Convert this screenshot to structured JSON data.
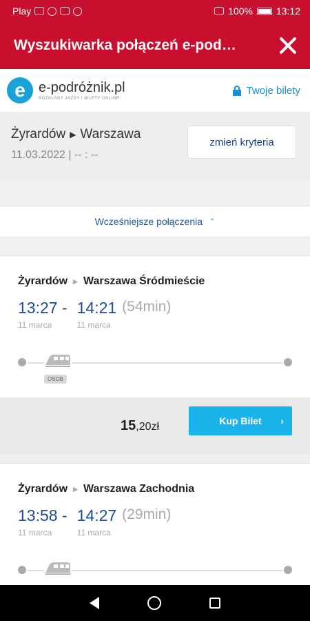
{
  "status": {
    "carrier": "Play",
    "battery": "100%",
    "time": "13:12"
  },
  "header": {
    "title": "Wyszukiwarka połączeń e-pod…"
  },
  "brand": {
    "logo_letter": "e",
    "name": "e-podróżnik.pl",
    "tagline": "ROZKŁADY JAZDY I BILETY ONLINE",
    "tickets_label": "Twoje bilety"
  },
  "search": {
    "from": "Żyrardów",
    "to": "Warszawa",
    "date": "11.03.2022 | -- : --",
    "change_label": "zmień kryteria"
  },
  "earlier_label": "Wcześniejsze połączenia",
  "connections": [
    {
      "from": "Żyrardów",
      "to": "Warszawa Śródmieście",
      "dep_time": "13:27 -",
      "dep_date": "11 marca",
      "arr_time": "14:21",
      "arr_date": "11 marca",
      "duration": "(54min)",
      "train_badge": "OSOB",
      "price_main": "15",
      "price_rest": ",20zł",
      "buy_label": "Kup Bilet"
    },
    {
      "from": "Żyrardów",
      "to": "Warszawa Zachodnia",
      "dep_time": "13:58 -",
      "dep_date": "11 marca",
      "arr_time": "14:27",
      "arr_date": "11 marca",
      "duration": "(29min)"
    }
  ]
}
